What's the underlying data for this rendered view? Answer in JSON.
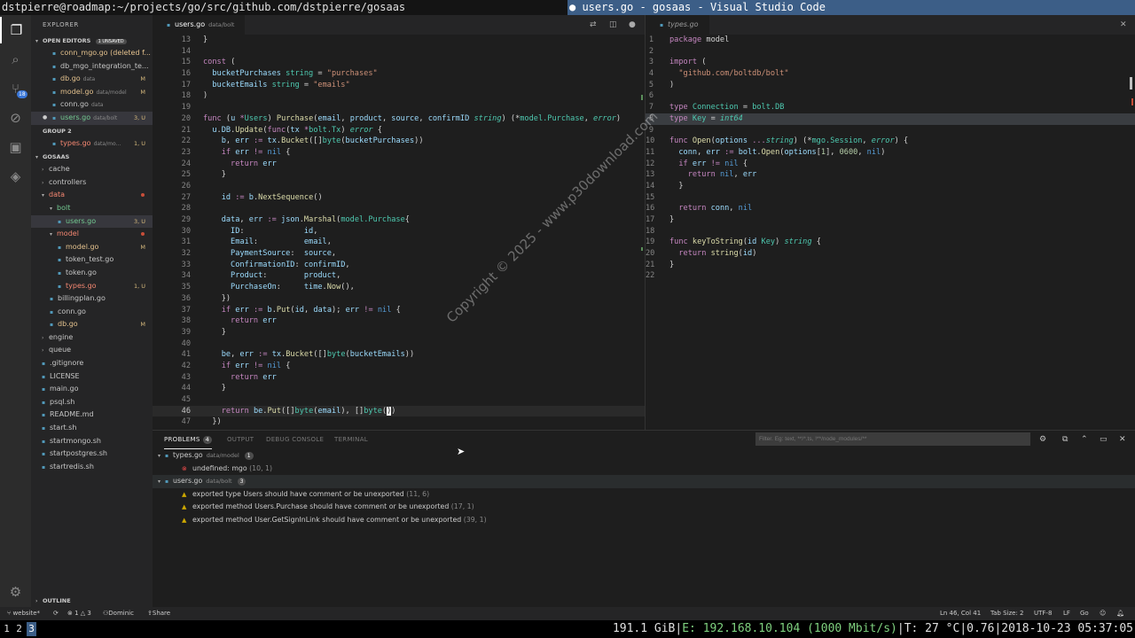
{
  "titlebar": {
    "left": "dstpierre@roadmap:~/projects/go/src/github.com/dstpierre/gosaas",
    "right": "● users.go - gosaas - Visual Studio Code"
  },
  "activity": {
    "scm_badge": "18"
  },
  "sidebar": {
    "title": "EXPLORER",
    "open_editors": "OPEN EDITORS",
    "unsaved": "1 UNSAVED",
    "open_items": [
      {
        "name": "conn_mgo.go (deleted f...",
        "dir": "",
        "status": "",
        "cls": "mod"
      },
      {
        "name": "db_mgo_integration_te...",
        "dir": "",
        "status": "",
        "cls": ""
      },
      {
        "name": "db.go",
        "dir": "data",
        "status": "M",
        "cls": "mod"
      },
      {
        "name": "model.go",
        "dir": "data/model",
        "status": "M",
        "cls": "mod"
      },
      {
        "name": "conn.go",
        "dir": "data",
        "status": "",
        "cls": ""
      },
      {
        "name": "users.go",
        "dir": "data/bolt",
        "status": "3, U",
        "cls": "green sel"
      }
    ],
    "group2": "GROUP 2",
    "group2_items": [
      {
        "name": "types.go",
        "dir": "data/mo...",
        "status": "1, U",
        "cls": "err"
      }
    ],
    "project": "GOSAAS",
    "tree": [
      {
        "name": "cache",
        "indent": 1,
        "type": "folder",
        "status": "",
        "cls": "",
        "dot": false
      },
      {
        "name": "controllers",
        "indent": 1,
        "type": "folder",
        "status": "",
        "cls": "",
        "dot": false
      },
      {
        "name": "data",
        "indent": 1,
        "type": "open",
        "status": "",
        "cls": "err",
        "dot": true
      },
      {
        "name": "bolt",
        "indent": 2,
        "type": "open",
        "status": "",
        "cls": "green",
        "dot": false
      },
      {
        "name": "users.go",
        "indent": 3,
        "type": "file",
        "status": "3, U",
        "cls": "green sel",
        "dot": false
      },
      {
        "name": "model",
        "indent": 2,
        "type": "open",
        "status": "",
        "cls": "err",
        "dot": true
      },
      {
        "name": "model.go",
        "indent": 3,
        "type": "file",
        "status": "M",
        "cls": "mod",
        "dot": false
      },
      {
        "name": "token_test.go",
        "indent": 3,
        "type": "file",
        "status": "",
        "cls": "",
        "dot": false
      },
      {
        "name": "token.go",
        "indent": 3,
        "type": "file",
        "status": "",
        "cls": "",
        "dot": false
      },
      {
        "name": "types.go",
        "indent": 3,
        "type": "file",
        "status": "1, U",
        "cls": "err",
        "dot": false
      },
      {
        "name": "billingplan.go",
        "indent": 2,
        "type": "file",
        "status": "",
        "cls": "",
        "dot": false
      },
      {
        "name": "conn.go",
        "indent": 2,
        "type": "file",
        "status": "",
        "cls": "",
        "dot": false
      },
      {
        "name": "db.go",
        "indent": 2,
        "type": "file",
        "status": "M",
        "cls": "mod",
        "dot": false
      },
      {
        "name": "engine",
        "indent": 1,
        "type": "folder",
        "status": "",
        "cls": "",
        "dot": false
      },
      {
        "name": "queue",
        "indent": 1,
        "type": "folder",
        "status": "",
        "cls": "",
        "dot": false
      },
      {
        "name": ".gitignore",
        "indent": 1,
        "type": "file",
        "status": "",
        "cls": "",
        "dot": false
      },
      {
        "name": "LICENSE",
        "indent": 1,
        "type": "file",
        "status": "",
        "cls": "",
        "dot": false
      },
      {
        "name": "main.go",
        "indent": 1,
        "type": "file",
        "status": "",
        "cls": "",
        "dot": false
      },
      {
        "name": "psql.sh",
        "indent": 1,
        "type": "file",
        "status": "",
        "cls": "",
        "dot": false
      },
      {
        "name": "README.md",
        "indent": 1,
        "type": "file",
        "status": "",
        "cls": "",
        "dot": false
      },
      {
        "name": "start.sh",
        "indent": 1,
        "type": "file",
        "status": "",
        "cls": "",
        "dot": false
      },
      {
        "name": "startmongo.sh",
        "indent": 1,
        "type": "file",
        "status": "",
        "cls": "",
        "dot": false
      },
      {
        "name": "startpostgres.sh",
        "indent": 1,
        "type": "file",
        "status": "",
        "cls": "",
        "dot": false
      },
      {
        "name": "startredis.sh",
        "indent": 1,
        "type": "file",
        "status": "",
        "cls": "",
        "dot": false
      }
    ],
    "outline": "OUTLINE"
  },
  "editor_left": {
    "tab_name": "users.go",
    "tab_dir": "data/bolt",
    "lines": [
      {
        "n": "13",
        "html": "<span class='o'>}</span>"
      },
      {
        "n": "14",
        "html": ""
      },
      {
        "n": "15",
        "html": "<span class='k'>const</span> <span class='o'>(</span>"
      },
      {
        "n": "16",
        "html": "  <span class='v'>bucketPurchases</span> <span class='t'>string</span> <span class='o'>=</span> <span class='s'>\"purchases\"</span>"
      },
      {
        "n": "17",
        "html": "  <span class='v'>bucketEmails</span> <span class='t'>string</span> <span class='o'>=</span> <span class='s'>\"emails\"</span>"
      },
      {
        "n": "18",
        "html": "<span class='o'>)</span>"
      },
      {
        "n": "19",
        "html": ""
      },
      {
        "n": "20",
        "html": "<span class='k'>func</span> <span class='o'>(</span><span class='v'>u</span> <span class='k'>*</span><span class='t'>Users</span><span class='o'>)</span> <span class='f'>Purchase</span><span class='o'>(</span><span class='v'>email</span>, <span class='v'>product</span>, <span class='v'>source</span>, <span class='v'>confirmID</span> <span class='t it'>string</span><span class='o'>)</span> <span class='o'>(*</span><span class='t'>model.Purchase</span>, <span class='t it'>error</span><span class='o'>)</span>"
      },
      {
        "n": "21",
        "html": "  <span class='v'>u</span>.<span class='v'>DB</span>.<span class='f'>Update</span><span class='o'>(</span><span class='k'>func</span><span class='o'>(</span><span class='v'>tx</span> <span class='k'>*</span><span class='t'>bolt.Tx</span><span class='o'>)</span> <span class='t it'>error</span> <span class='o'>{</span>"
      },
      {
        "n": "22",
        "html": "    <span class='v'>b</span>, <span class='v'>err</span> <span class='k'>:=</span> <span class='v'>tx</span>.<span class='f'>Bucket</span><span class='o'>([]</span><span class='t'>byte</span><span class='o'>(</span><span class='v'>bucketPurchases</span><span class='o'>))</span>"
      },
      {
        "n": "23",
        "html": "    <span class='k'>if</span> <span class='v'>err</span> <span class='k'>!=</span> <span class='k2'>nil</span> <span class='o'>{</span>"
      },
      {
        "n": "24",
        "html": "      <span class='k'>return</span> <span class='v'>err</span>"
      },
      {
        "n": "25",
        "html": "    <span class='o'>}</span>"
      },
      {
        "n": "26",
        "html": ""
      },
      {
        "n": "27",
        "html": "    <span class='v'>id</span> <span class='k'>:=</span> <span class='v'>b</span>.<span class='f'>NextSequence</span><span class='o'>()</span>"
      },
      {
        "n": "28",
        "html": ""
      },
      {
        "n": "29",
        "html": "    <span class='v'>data</span>, <span class='v'>err</span> <span class='k'>:=</span> <span class='v'>json</span>.<span class='f'>Marshal</span><span class='o'>(</span><span class='t'>model.Purchase</span><span class='o'>{</span>"
      },
      {
        "n": "30",
        "html": "      <span class='v'>ID</span>:             <span class='v'>id</span>,"
      },
      {
        "n": "31",
        "html": "      <span class='v'>Email</span>:          <span class='v'>email</span>,"
      },
      {
        "n": "32",
        "html": "      <span class='v'>PaymentSource</span>:  <span class='v'>source</span>,"
      },
      {
        "n": "33",
        "html": "      <span class='v'>ConfirmationID</span>: <span class='v'>confirmID</span>,"
      },
      {
        "n": "34",
        "html": "      <span class='v'>Product</span>:        <span class='v'>product</span>,"
      },
      {
        "n": "35",
        "html": "      <span class='v'>PurchaseOn</span>:     <span class='v'>time</span>.<span class='f'>Now</span><span class='o'>(),</span>"
      },
      {
        "n": "36",
        "html": "    <span class='o'>})</span>"
      },
      {
        "n": "37",
        "html": "    <span class='k'>if</span> <span class='v'>err</span> <span class='k'>:=</span> <span class='v'>b</span>.<span class='f'>Put</span><span class='o'>(</span><span class='v'>id</span>, <span class='v'>data</span><span class='o'>);</span> <span class='v'>err</span> <span class='k'>!=</span> <span class='k2'>nil</span> <span class='o'>{</span>"
      },
      {
        "n": "38",
        "html": "      <span class='k'>return</span> <span class='v'>err</span>"
      },
      {
        "n": "39",
        "html": "    <span class='o'>}</span>"
      },
      {
        "n": "40",
        "html": ""
      },
      {
        "n": "41",
        "html": "    <span class='v'>be</span>, <span class='v'>err</span> <span class='k'>:=</span> <span class='v'>tx</span>.<span class='f'>Bucket</span><span class='o'>([]</span><span class='t'>byte</span><span class='o'>(</span><span class='v'>bucketEmails</span><span class='o'>))</span>"
      },
      {
        "n": "42",
        "html": "    <span class='k'>if</span> <span class='v'>err</span> <span class='k'>!=</span> <span class='k2'>nil</span> <span class='o'>{</span>"
      },
      {
        "n": "43",
        "html": "      <span class='k'>return</span> <span class='v'>err</span>"
      },
      {
        "n": "44",
        "html": "    <span class='o'>}</span>"
      },
      {
        "n": "45",
        "html": ""
      },
      {
        "n": "46",
        "html": "    <span class='k'>return</span> <span class='v'>be</span>.<span class='f'>Put</span><span class='o'>([]</span><span class='t'>byte</span><span class='o'>(</span><span class='v'>email</span><span class='o'>),</span> <span class='o'>[]</span><span class='t'>byte</span><span class='o'>(</span><span style='background:#fff;color:#000'>)</span><span class='o'>)</span>"
      },
      {
        "n": "47",
        "html": "  <span class='o'>})</span>"
      }
    ],
    "cursor_line": "46"
  },
  "editor_right": {
    "tab_name": "types.go",
    "lines": [
      {
        "n": "1",
        "html": "<span class='k'>package</span> <span class='o'>model</span>"
      },
      {
        "n": "2",
        "html": ""
      },
      {
        "n": "3",
        "html": "<span class='k'>import</span> <span class='o'>(</span>"
      },
      {
        "n": "4",
        "html": "  <span class='s'>\"github.com/boltdb/bolt\"</span>"
      },
      {
        "n": "5",
        "html": "<span class='o'>)</span>"
      },
      {
        "n": "6",
        "html": ""
      },
      {
        "n": "7",
        "html": "<span class='k'>type</span> <span class='t'>Connection</span> <span class='o'>=</span> <span class='t'>bolt.DB</span>"
      },
      {
        "n": "8",
        "html": "<span class='k'>type</span> <span class='t'>Key</span> <span class='o'>=</span> <span class='t it'>int64</span>"
      },
      {
        "n": "9",
        "html": ""
      },
      {
        "n": "10",
        "html": "<span class='k'>func</span> <span class='f'>Open</span><span class='o'>(</span><span class='v'>options</span> <span class='k'>...</span><span class='t it'>string</span><span class='o'>)</span> <span class='o'>(*</span><span class='t'>mgo.Session</span>, <span class='t it'>error</span><span class='o'>)</span> <span class='o'>{</span>"
      },
      {
        "n": "11",
        "html": "  <span class='v'>conn</span>, <span class='v'>err</span> <span class='k'>:=</span> <span class='v'>bolt</span>.<span class='f'>Open</span><span class='o'>(</span><span class='v'>options</span><span class='o'>[</span><span class='nm'>1</span><span class='o'>],</span> <span class='nm'>0600</span>, <span class='k2'>nil</span><span class='o'>)</span>"
      },
      {
        "n": "12",
        "html": "  <span class='k'>if</span> <span class='v'>err</span> <span class='k'>!=</span> <span class='k2'>nil</span> <span class='o'>{</span>"
      },
      {
        "n": "13",
        "html": "    <span class='k'>return</span> <span class='k2'>nil</span>, <span class='v'>err</span>"
      },
      {
        "n": "14",
        "html": "  <span class='o'>}</span>"
      },
      {
        "n": "15",
        "html": ""
      },
      {
        "n": "16",
        "html": "  <span class='k'>return</span> <span class='v'>conn</span>, <span class='k2'>nil</span>"
      },
      {
        "n": "17",
        "html": "<span class='o'>}</span>"
      },
      {
        "n": "18",
        "html": ""
      },
      {
        "n": "19",
        "html": "<span class='k'>func</span> <span class='f'>keyToString</span><span class='o'>(</span><span class='v'>id</span> <span class='t'>Key</span><span class='o'>)</span> <span class='t it'>string</span> <span class='o'>{</span>"
      },
      {
        "n": "20",
        "html": "  <span class='k'>return</span> <span class='f'>string</span><span class='o'>(</span><span class='v'>id</span><span class='o'>)</span>"
      },
      {
        "n": "21",
        "html": "<span class='o'>}</span>"
      },
      {
        "n": "22",
        "html": ""
      }
    ],
    "cursor_line": "8"
  },
  "watermark": "Copyright © 2025 - www.p30download.com",
  "panel": {
    "tabs": {
      "problems": "PROBLEMS",
      "problems_count": "4",
      "output": "OUTPUT",
      "debug": "DEBUG CONSOLE",
      "terminal": "TERMINAL"
    },
    "filter_placeholder": "Filter. Eg: text, **/*.ts, !**/node_modules/**",
    "groups": [
      {
        "file": "types.go",
        "dir": "data/model",
        "count": "1",
        "items": [
          {
            "kind": "error",
            "msg": "undefined: mgo",
            "loc": "(10, 1)"
          }
        ]
      },
      {
        "file": "users.go",
        "dir": "data/bolt",
        "count": "3",
        "items": [
          {
            "kind": "warn",
            "msg": "exported type Users should have comment or be unexported",
            "loc": "(11, 6)"
          },
          {
            "kind": "warn",
            "msg": "exported method Users.Purchase should have comment or be unexported",
            "loc": "(17, 1)"
          },
          {
            "kind": "warn",
            "msg": "exported method User.GetSignInLink should have comment or be unexported",
            "loc": "(39, 1)"
          }
        ]
      }
    ]
  },
  "statusbar": {
    "branch": "website*",
    "errors": "1",
    "warnings": "3",
    "user": "Dominic",
    "share": "Share",
    "position": "Ln 46, Col 41",
    "tab_size": "Tab Size: 2",
    "encoding": "UTF-8",
    "eol": "LF",
    "lang": "Go"
  },
  "taskbar": {
    "ws": [
      "1",
      "2",
      "3"
    ],
    "disk": "191.1 GiB",
    "eth": "E: 192.168.10.104 (1000 Mbit/s)",
    "temp": "T: 27 °C",
    "load": "0.76",
    "datetime": "2018-10-23 05:37:05"
  }
}
